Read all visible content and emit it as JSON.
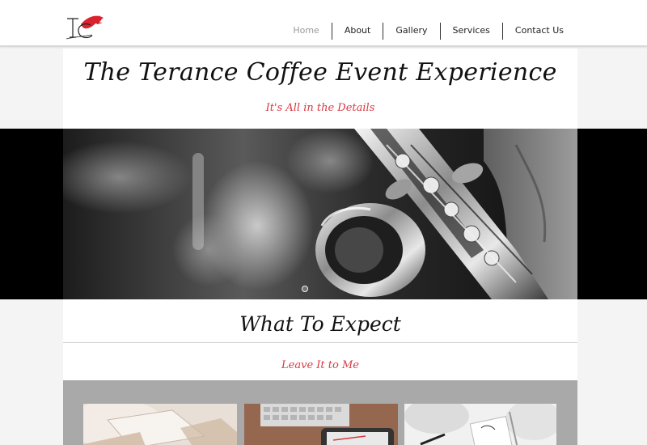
{
  "header": {
    "logo_text": "TC",
    "nav": [
      {
        "label": "Home",
        "active": true
      },
      {
        "label": "About",
        "active": false
      },
      {
        "label": "Gallery",
        "active": false
      },
      {
        "label": "Services",
        "active": false
      },
      {
        "label": "Contact Us",
        "active": false
      }
    ]
  },
  "hero": {
    "title": "The Terance Coffee Event Experience",
    "subtitle": "It's All in the Details",
    "image_icon": "saxophone-photo"
  },
  "expect": {
    "title": "What To Expect",
    "subtitle": "Leave It to Me"
  },
  "cards": [
    {
      "icon": "notebook-photo"
    },
    {
      "icon": "keyboard-tablet-photo"
    },
    {
      "icon": "table-setting-photo"
    }
  ],
  "colors": {
    "accent": "#d63a43",
    "text": "#111111",
    "nav_active": "#9a9a9a",
    "background": "#f4f4f4"
  }
}
